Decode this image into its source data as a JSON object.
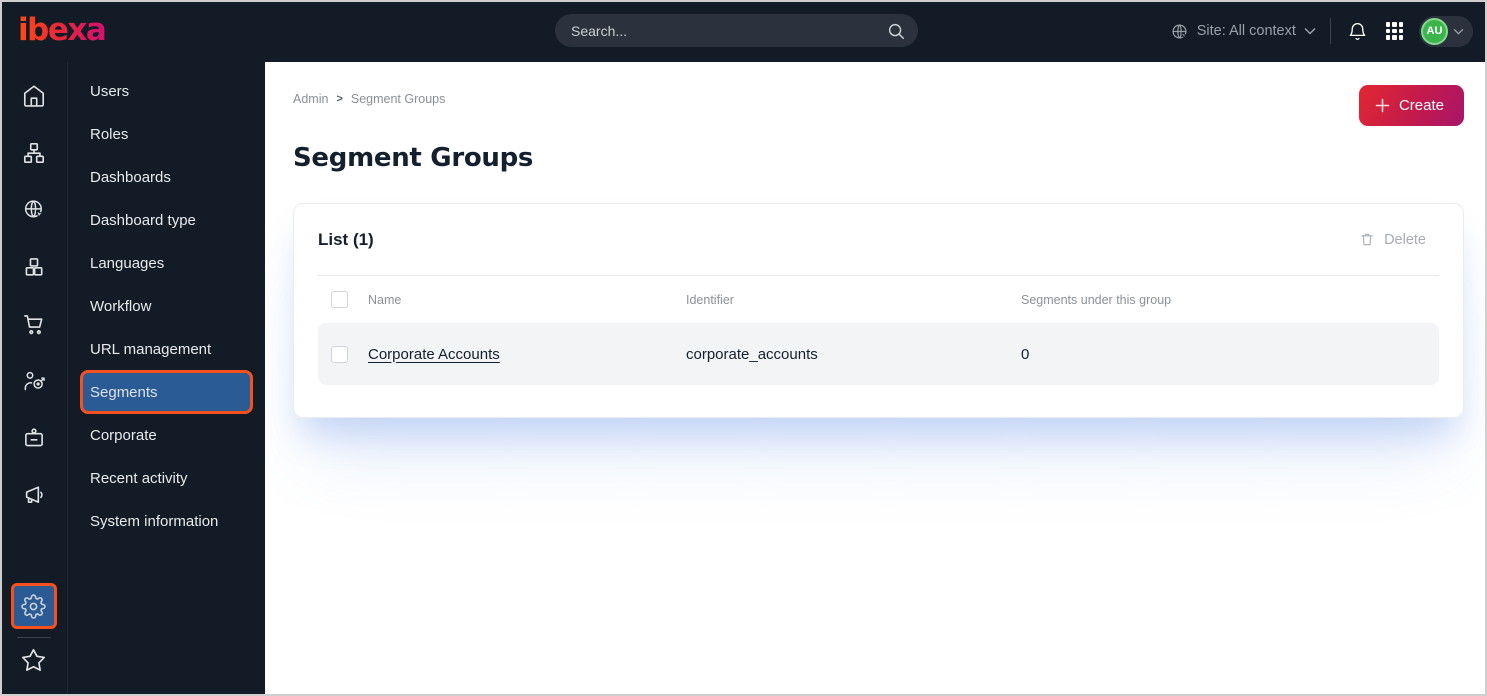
{
  "topbar": {
    "logo_text": "ibexa",
    "search_placeholder": "Search...",
    "site_context_label": "Site: All context",
    "avatar_initials": "AU"
  },
  "iconbar": {
    "icons": [
      "home",
      "site-structure",
      "site",
      "products",
      "cart",
      "customers",
      "badge",
      "marketing",
      "settings",
      "favorites"
    ],
    "active_icon": "settings"
  },
  "sidebar": {
    "items": [
      "Users",
      "Roles",
      "Dashboards",
      "Dashboard type",
      "Languages",
      "Workflow",
      "URL management",
      "Segments",
      "Corporate",
      "Recent activity",
      "System information"
    ],
    "active_item": "Segments"
  },
  "main": {
    "breadcrumb": {
      "items": [
        "Admin",
        "Segment Groups"
      ],
      "separator": ">"
    },
    "title": "Segment Groups",
    "create_button_label": "Create",
    "list_card": {
      "heading": "List (1)",
      "delete_button_label": "Delete",
      "columns": [
        "Name",
        "Identifier",
        "Segments under this group"
      ],
      "rows": [
        {
          "name": "Corporate Accounts",
          "identifier": "corporate_accounts",
          "segments_count": "0"
        }
      ]
    }
  },
  "colors": {
    "topbar_bg": "#131c26",
    "active_highlight_blue": "#2b5b95",
    "focus_outline_orange": "#f4511e",
    "create_gradient_start": "#e02634",
    "create_gradient_end": "#a8156a",
    "avatar_green": "#3db54d",
    "row_bg": "#f3f4f6",
    "card_glow": "rgba(96,140,230,0.28)"
  }
}
